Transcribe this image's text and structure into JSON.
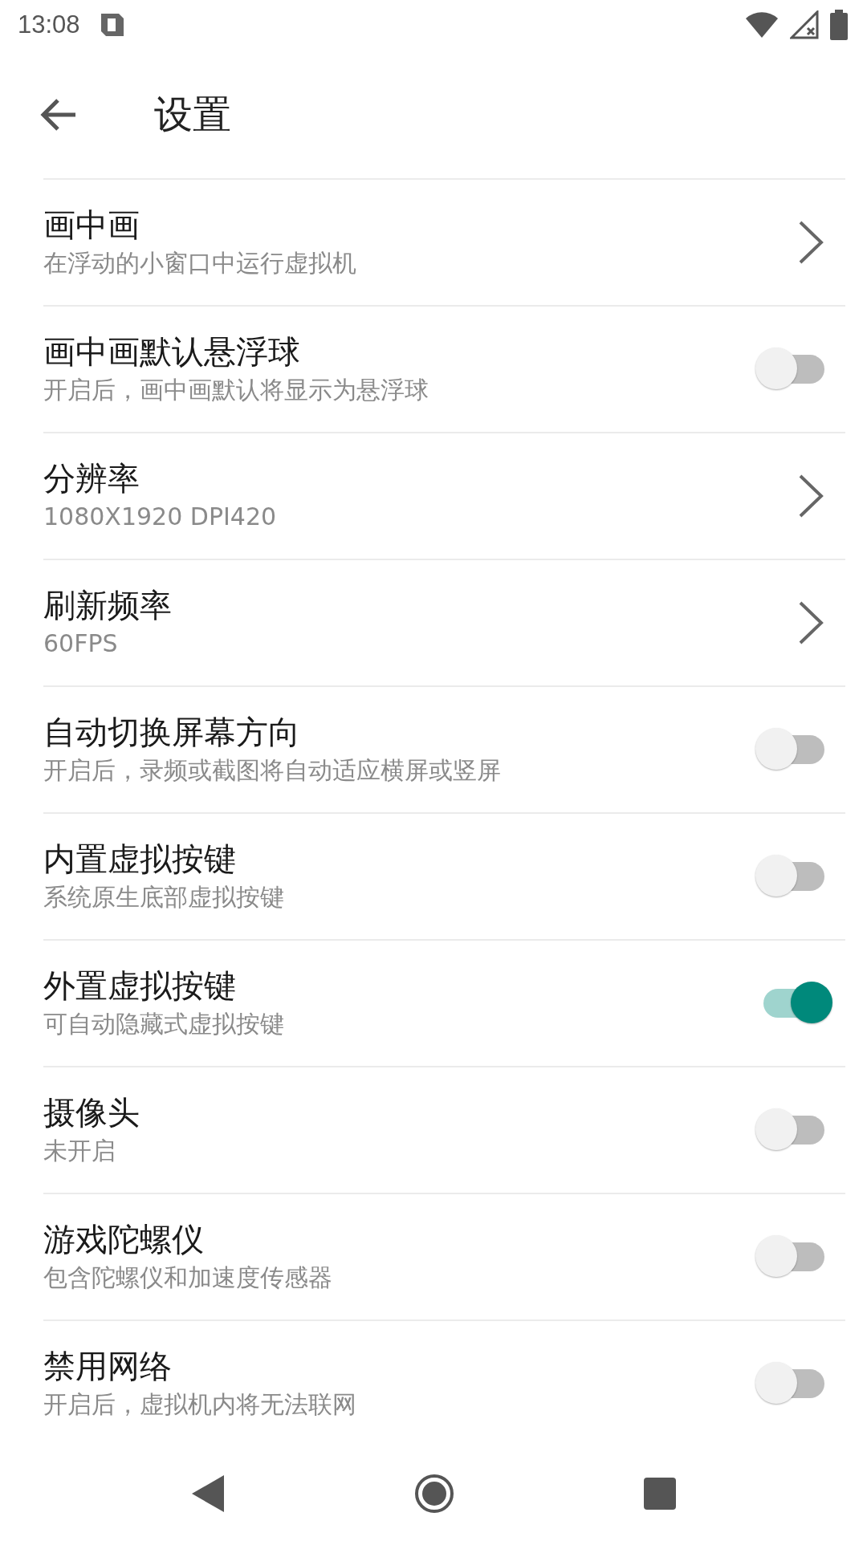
{
  "status_bar": {
    "time": "13:08"
  },
  "toolbar": {
    "title": "设置"
  },
  "settings": [
    {
      "kind": "link",
      "title": "画中画",
      "subtitle": "在浮动的小窗口中运行虚拟机"
    },
    {
      "kind": "toggle",
      "title": "画中画默认悬浮球",
      "subtitle": "开启后，画中画默认将显示为悬浮球",
      "on": false
    },
    {
      "kind": "link",
      "title": "分辨率",
      "subtitle": "1080X1920 DPI420"
    },
    {
      "kind": "link",
      "title": "刷新频率",
      "subtitle": "60FPS"
    },
    {
      "kind": "toggle",
      "title": "自动切换屏幕方向",
      "subtitle": "开启后，录频或截图将自动适应横屏或竖屏",
      "on": false
    },
    {
      "kind": "toggle",
      "title": "内置虚拟按键",
      "subtitle": "系统原生底部虚拟按键",
      "on": false
    },
    {
      "kind": "toggle",
      "title": "外置虚拟按键",
      "subtitle": "可自动隐藏式虚拟按键",
      "on": true
    },
    {
      "kind": "toggle",
      "title": "摄像头",
      "subtitle": "未开启",
      "on": false
    },
    {
      "kind": "toggle",
      "title": "游戏陀螺仪",
      "subtitle": "包含陀螺仪和加速度传感器",
      "on": false
    },
    {
      "kind": "toggle",
      "title": "禁用网络",
      "subtitle": "开启后，虚拟机内将无法联网",
      "on": false
    }
  ]
}
